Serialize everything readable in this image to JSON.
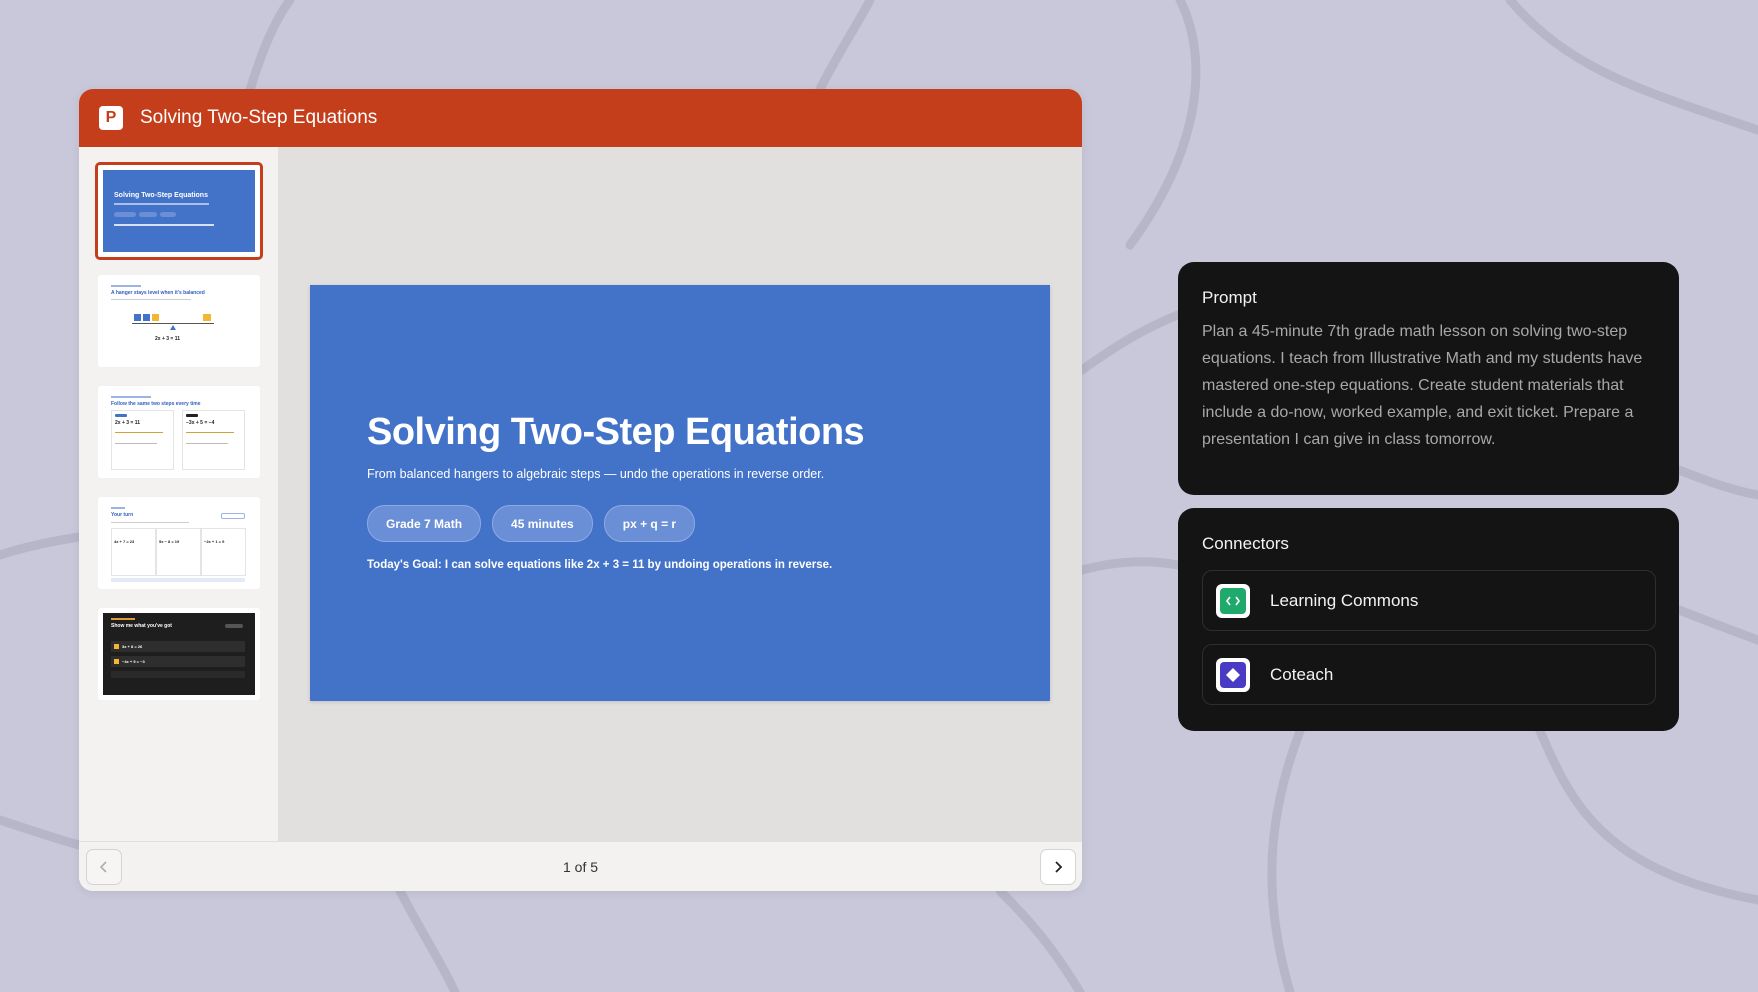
{
  "window": {
    "app_icon_letter": "P",
    "title": "Solving Two-Step Equations"
  },
  "slide": {
    "title": "Solving Two-Step Equations",
    "subtitle": "From balanced hangers to algebraic steps — undo the operations in reverse order.",
    "chips": [
      "Grade 7 Math",
      "45 minutes",
      "px + q = r"
    ],
    "goal": "Today's Goal: I can solve equations like 2x + 3 = 11 by undoing operations in reverse."
  },
  "thumbnails": [
    {
      "title": "Solving Two-Step Equations",
      "selected": true
    },
    {
      "title": "A hanger stays level when it's balanced",
      "caption": "2x + 3 = 11"
    },
    {
      "title": "Follow the same two steps every time",
      "left": "2x + 3 = 11",
      "right": "−3x + 5 = −4"
    },
    {
      "title": "Your turn",
      "items": [
        "4x + 7 = 23",
        "5x − 8 = 19",
        "−2x + 1 = 9"
      ]
    },
    {
      "title": "Show me what you've got",
      "items": [
        "3x + 8 = 26",
        "−4x + 9 = −3"
      ]
    }
  ],
  "pager": {
    "label": "1 of 5",
    "current": 1,
    "total": 5
  },
  "prompt": {
    "heading": "Prompt",
    "text": "Plan a 45-minute 7th grade math lesson on solving two-step equations. I teach from Illustrative Math and my students have mastered one-step equations. Create student materials that include a do-now, worked example, and exit ticket. Prepare a presentation I can give in class tomorrow."
  },
  "connectors": {
    "heading": "Connectors",
    "items": [
      {
        "label": "Learning Commons",
        "icon": "code-brackets-icon",
        "color": "#1faa6b"
      },
      {
        "label": "Coteach",
        "icon": "diamond-icon",
        "color": "#4a3bc4"
      }
    ]
  },
  "colors": {
    "ppt_accent": "#c43e1c",
    "slide_blue": "#4373c9",
    "panel_bg": "#141414",
    "background": "#c9c8da"
  }
}
